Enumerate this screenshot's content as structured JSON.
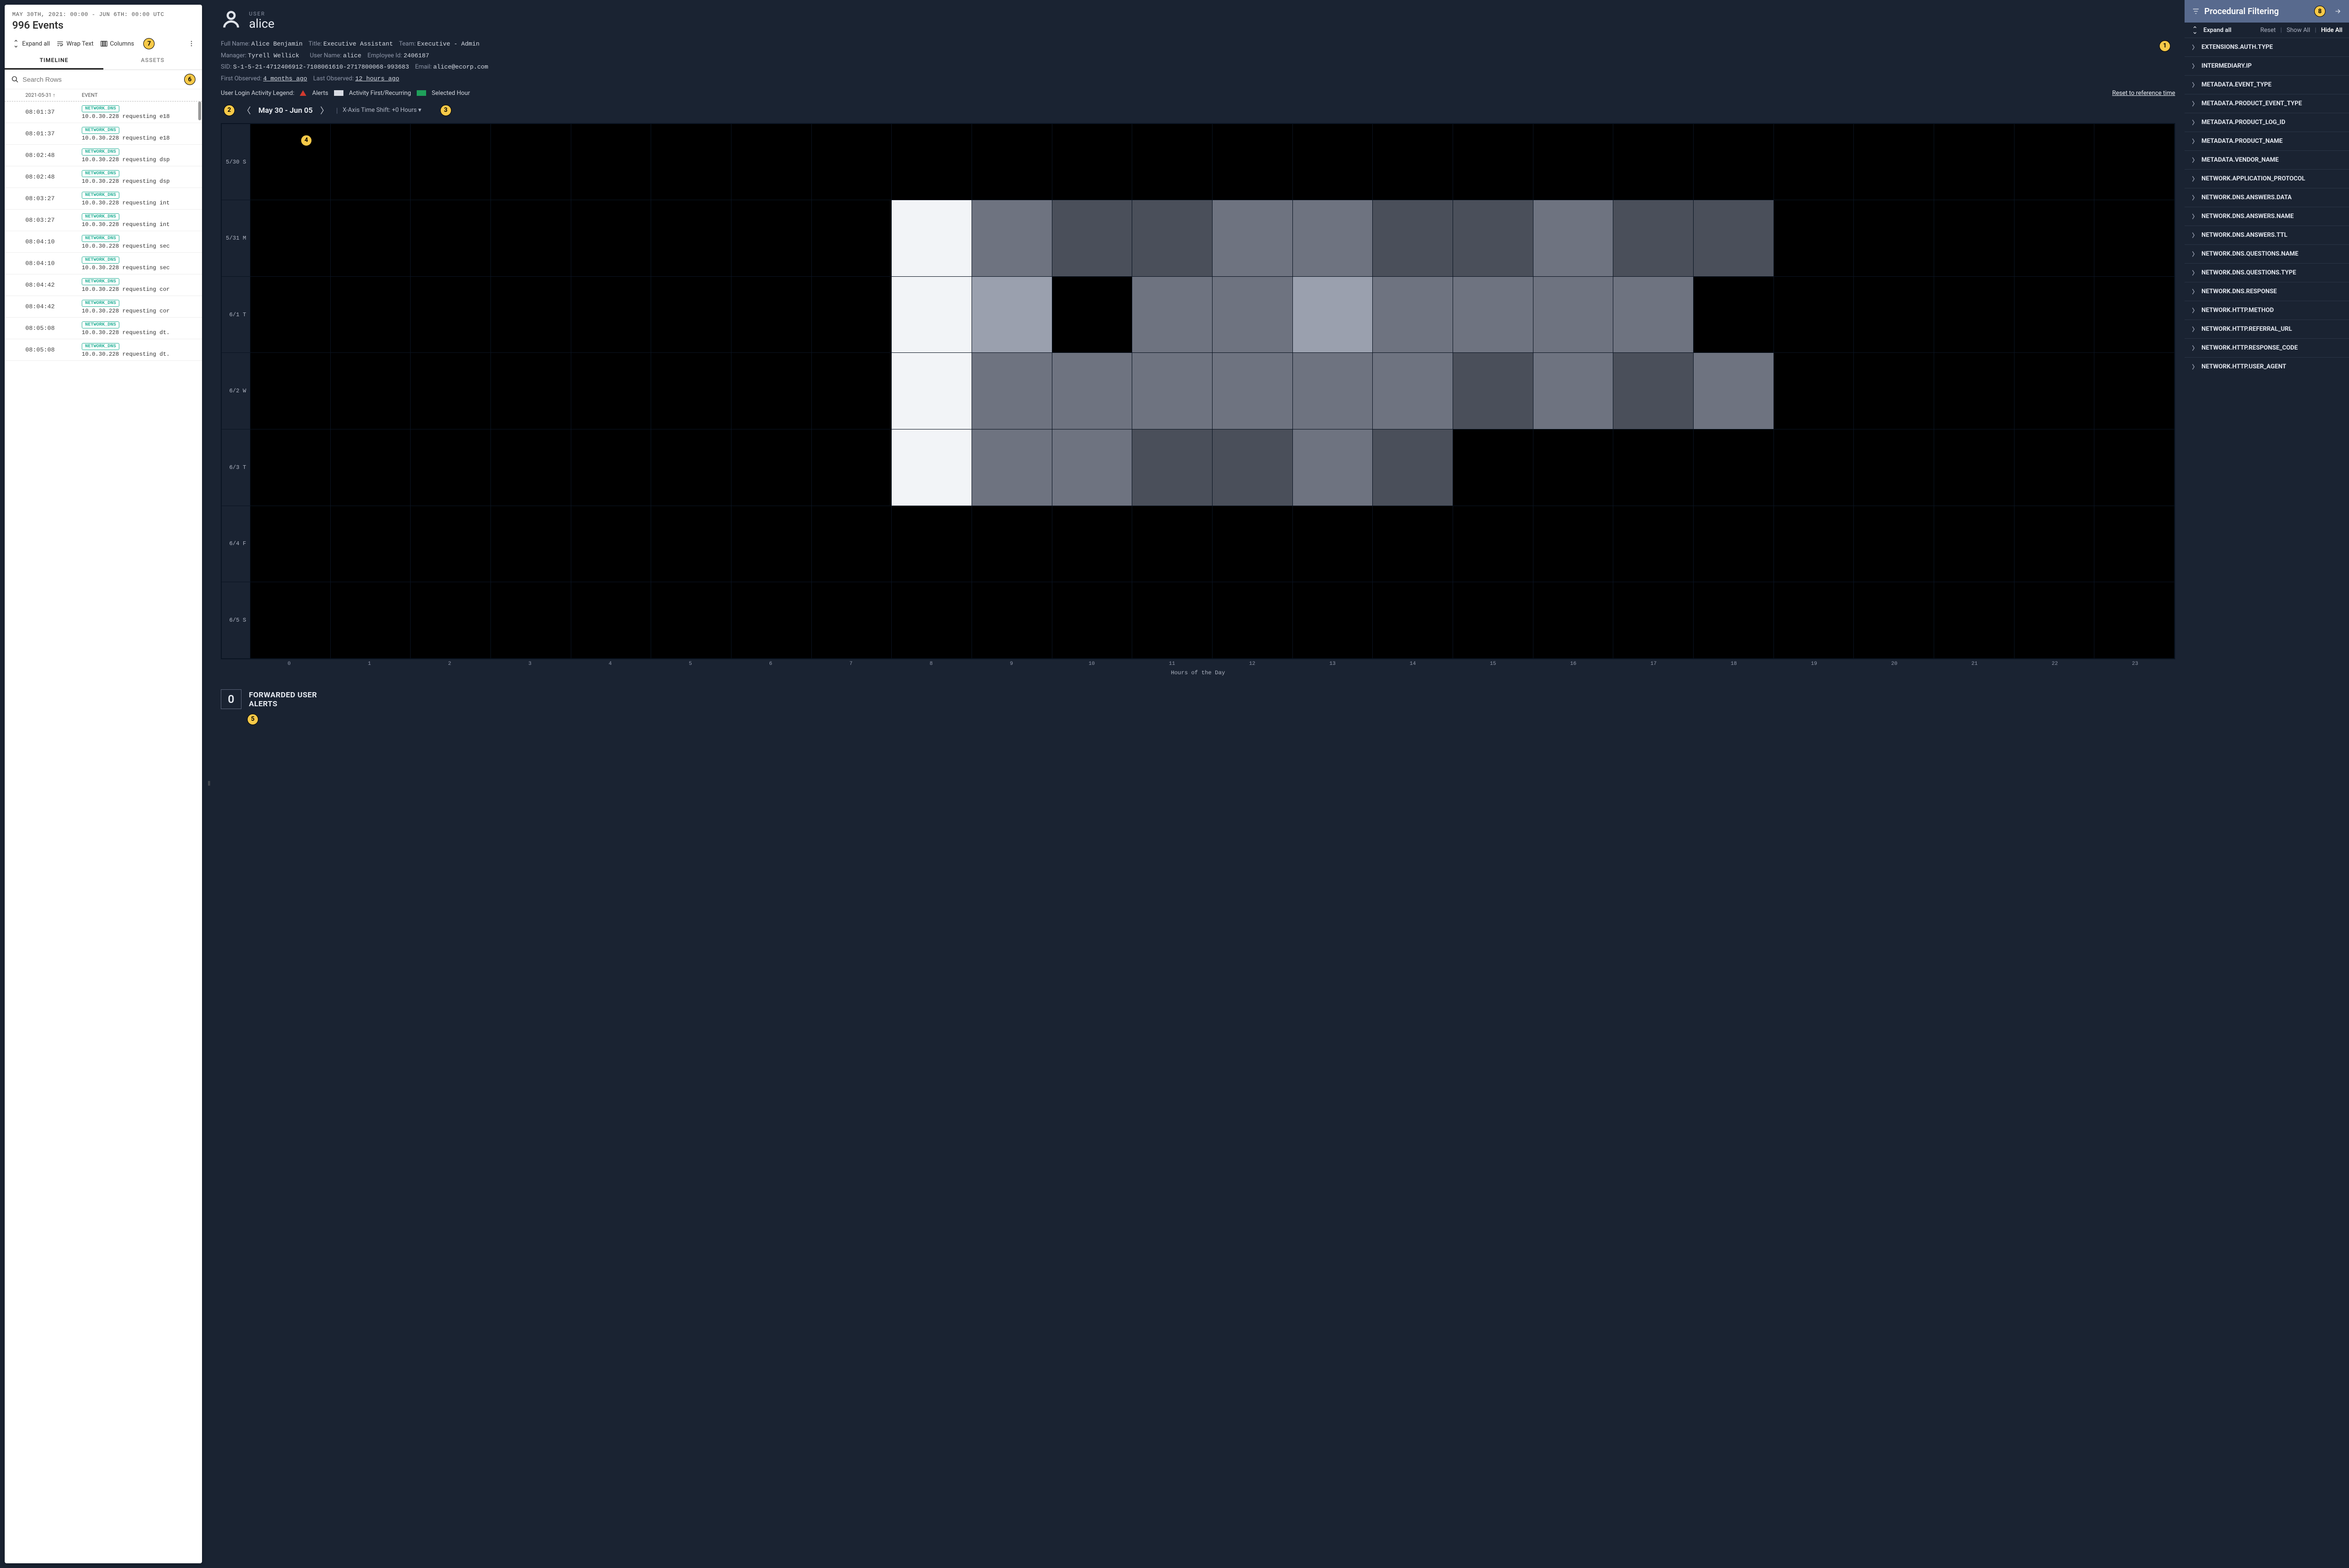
{
  "left": {
    "date_range": "MAY 30TH, 2021: 00:00 - JUN 6TH: 00:00 UTC",
    "event_count": "996 Events",
    "tools": {
      "expand": "Expand all",
      "wrap": "Wrap Text",
      "columns": "Columns"
    },
    "tabs": {
      "timeline": "TIMELINE",
      "assets": "ASSETS"
    },
    "search_placeholder": "Search Rows",
    "col_date": "2021-05-31 ↑",
    "col_event": "EVENT",
    "rows": [
      {
        "time": "08:01:37",
        "tag": "NETWORK_DNS",
        "text": "10.0.30.228 requesting e18"
      },
      {
        "time": "08:01:37",
        "tag": "NETWORK_DNS",
        "text": "10.0.30.228 requesting e18"
      },
      {
        "time": "08:02:48",
        "tag": "NETWORK_DNS",
        "text": "10.0.30.228 requesting dsp"
      },
      {
        "time": "08:02:48",
        "tag": "NETWORK_DNS",
        "text": "10.0.30.228 requesting dsp"
      },
      {
        "time": "08:03:27",
        "tag": "NETWORK_DNS",
        "text": "10.0.30.228 requesting int"
      },
      {
        "time": "08:03:27",
        "tag": "NETWORK_DNS",
        "text": "10.0.30.228 requesting int"
      },
      {
        "time": "08:04:10",
        "tag": "NETWORK_DNS",
        "text": "10.0.30.228 requesting sec"
      },
      {
        "time": "08:04:10",
        "tag": "NETWORK_DNS",
        "text": "10.0.30.228 requesting sec"
      },
      {
        "time": "08:04:42",
        "tag": "NETWORK_DNS",
        "text": "10.0.30.228 requesting cor"
      },
      {
        "time": "08:04:42",
        "tag": "NETWORK_DNS",
        "text": "10.0.30.228 requesting cor"
      },
      {
        "time": "08:05:08",
        "tag": "NETWORK_DNS",
        "text": "10.0.30.228 requesting dt."
      },
      {
        "time": "08:05:08",
        "tag": "NETWORK_DNS",
        "text": "10.0.30.228 requesting dt."
      }
    ]
  },
  "center": {
    "entity_label": "USER",
    "entity_name": "alice",
    "details": {
      "full_name_l": "Full Name:",
      "full_name": "Alice Benjamin",
      "title_l": "Title:",
      "title": "Executive Assistant",
      "team_l": "Team:",
      "team": "Executive - Admin",
      "manager_l": "Manager:",
      "manager": "Tyrell Wellick",
      "user_name_l": "User Name:",
      "user_name": "alice",
      "emp_id_l": "Employee Id:",
      "emp_id": "2406187",
      "sid_l": "SID:",
      "sid": "S-1-5-21-4712406912-7108061610-2717800068-993683",
      "email_l": "Email:",
      "email": "alice@ecorp.com",
      "first_l": "First Observed:",
      "first": "4 months ago",
      "last_l": "Last Observed:",
      "last": "12 hours ago"
    },
    "legend": {
      "title": "User Login Activity Legend:",
      "alerts": "Alerts",
      "activity": "Activity First/Recurring",
      "selected": "Selected Hour",
      "reset": "Reset to reference time"
    },
    "nav": {
      "range": "May 30 - Jun 05",
      "shift_label": "X-Axis Time Shift:",
      "shift_value": "+0 Hours"
    },
    "alerts": {
      "count": "0",
      "label1": "FORWARDED USER",
      "label2": "ALERTS"
    }
  },
  "chart_data": {
    "type": "heatmap",
    "title": "User Login Activity",
    "xlabel": "Hours of the Day",
    "x_ticks": [
      "0",
      "1",
      "2",
      "3",
      "4",
      "5",
      "6",
      "7",
      "8",
      "9",
      "10",
      "11",
      "12",
      "13",
      "14",
      "15",
      "16",
      "17",
      "18",
      "19",
      "20",
      "21",
      "22",
      "23"
    ],
    "y_labels": [
      "5/30 S",
      "5/31 M",
      "6/1 T",
      "6/2 W",
      "6/3 T",
      "6/4 F",
      "6/5 S"
    ],
    "intensity_scale": "0=none, 5=white (earliest/strongest)",
    "grid": [
      [
        0,
        0,
        0,
        0,
        0,
        0,
        0,
        0,
        0,
        0,
        0,
        0,
        0,
        0,
        0,
        0,
        0,
        0,
        0,
        0,
        0,
        0,
        0,
        0
      ],
      [
        0,
        0,
        0,
        0,
        0,
        0,
        0,
        0,
        5,
        2,
        1,
        1,
        2,
        2,
        1,
        1,
        2,
        1,
        1,
        0,
        0,
        0,
        0,
        0
      ],
      [
        0,
        0,
        0,
        0,
        0,
        0,
        0,
        0,
        5,
        3,
        0,
        2,
        2,
        3,
        2,
        2,
        2,
        2,
        0,
        0,
        0,
        0,
        0,
        0
      ],
      [
        0,
        0,
        0,
        0,
        0,
        0,
        0,
        0,
        5,
        2,
        2,
        2,
        2,
        2,
        2,
        1,
        2,
        1,
        2,
        0,
        0,
        0,
        0,
        0
      ],
      [
        0,
        0,
        0,
        0,
        0,
        0,
        0,
        0,
        5,
        2,
        2,
        1,
        1,
        2,
        1,
        0,
        0,
        0,
        0,
        0,
        0,
        0,
        0,
        0
      ],
      [
        0,
        0,
        0,
        0,
        0,
        0,
        0,
        0,
        0,
        0,
        0,
        0,
        0,
        0,
        0,
        0,
        0,
        0,
        0,
        0,
        0,
        0,
        0,
        0
      ],
      [
        0,
        0,
        0,
        0,
        0,
        0,
        0,
        0,
        0,
        0,
        0,
        0,
        0,
        0,
        0,
        0,
        0,
        0,
        0,
        0,
        0,
        0,
        0,
        0
      ]
    ],
    "palette": {
      "0": "#000000",
      "1": "#4a4f5a",
      "2": "#6e7380",
      "3": "#9aa0ae",
      "4": "#c9cdd6",
      "5": "#f2f4f7"
    }
  },
  "right": {
    "title": "Procedural Filtering",
    "expand": "Expand all",
    "reset": "Reset",
    "show": "Show All",
    "hide": "Hide All",
    "items": [
      "EXTENSIONS.AUTH.TYPE",
      "INTERMEDIARY.IP",
      "METADATA.EVENT_TYPE",
      "METADATA.PRODUCT_EVENT_TYPE",
      "METADATA.PRODUCT_LOG_ID",
      "METADATA.PRODUCT_NAME",
      "METADATA.VENDOR_NAME",
      "NETWORK.APPLICATION_PROTOCOL",
      "NETWORK.DNS.ANSWERS.DATA",
      "NETWORK.DNS.ANSWERS.NAME",
      "NETWORK.DNS.ANSWERS.TTL",
      "NETWORK.DNS.QUESTIONS.NAME",
      "NETWORK.DNS.QUESTIONS.TYPE",
      "NETWORK.DNS.RESPONSE",
      "NETWORK.HTTP.METHOD",
      "NETWORK.HTTP.REFERRAL_URL",
      "NETWORK.HTTP.RESPONSE_CODE",
      "NETWORK.HTTP.USER_AGENT"
    ]
  },
  "badges": {
    "b1": "1",
    "b2": "2",
    "b3": "3",
    "b4": "4",
    "b5": "5",
    "b6": "6",
    "b7": "7",
    "b8": "8"
  }
}
